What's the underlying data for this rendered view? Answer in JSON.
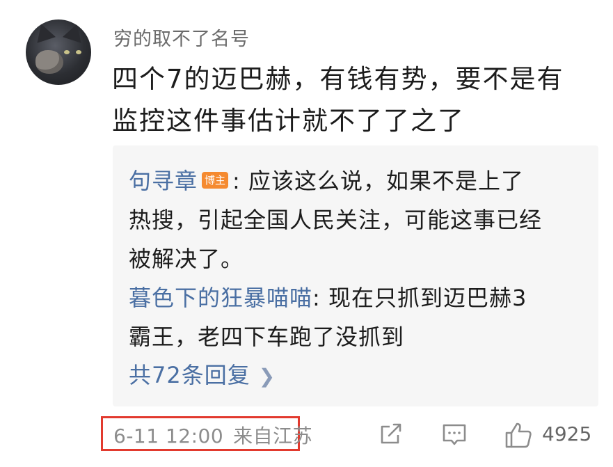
{
  "comment": {
    "username": "穷的取不了名号",
    "text_lines": [
      "四个7的迈巴赫，有钱有势，要不是有",
      "监控这件事估计就不了了之了"
    ],
    "avatar_icon": "cat-avatar-icon"
  },
  "replies": [
    {
      "author": "句寻章",
      "badge": "博主",
      "line1": ": 应该这么说，如果不是上了",
      "line2": "热搜，引起全国人民关注，可能这事已经",
      "line3": "被解决了。"
    },
    {
      "author": "暮色下的狂暴喵喵",
      "line1": ": 现在只抓到迈巴赫3",
      "line2": "霸王，老四下车跑了没抓到"
    }
  ],
  "more_replies": {
    "label": "共72条回复",
    "icon": "chevron-right-icon"
  },
  "footer": {
    "timestamp": "6-11 12:00",
    "location": "来自江苏",
    "like_count": "4925",
    "icons": [
      "share-icon",
      "comment-icon",
      "thumbs-up-icon"
    ]
  },
  "colors": {
    "author_link": "#4a6fa3",
    "badge_bg": "#f58a30",
    "highlight_border": "#e23a2e",
    "reply_bg": "#f6f6f6"
  }
}
